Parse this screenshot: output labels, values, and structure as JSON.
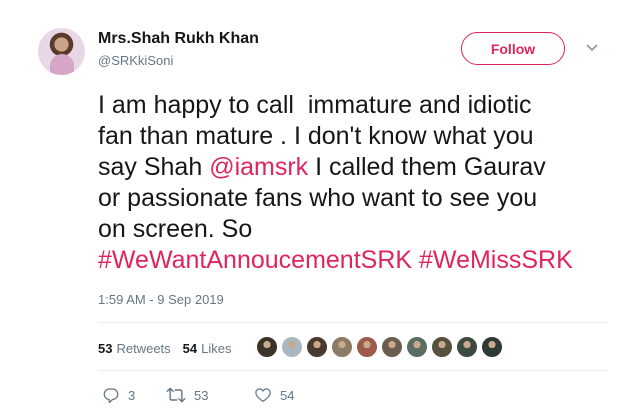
{
  "author": {
    "display_name": "Mrs.Shah Rukh Khan",
    "handle": "@SRKkiSoni"
  },
  "follow_button": {
    "label": "Follow"
  },
  "tweet": {
    "lines": [
      [
        {
          "text": "I am happy to call  immature and idiotic",
          "link": false
        }
      ],
      [
        {
          "text": "fan than mature . I don't know what you",
          "link": false
        }
      ],
      [
        {
          "text": "say Shah ",
          "link": false
        },
        {
          "text": "@iamsrk",
          "link": true
        },
        {
          "text": " I called them Gaurav",
          "link": false
        }
      ],
      [
        {
          "text": "or passionate fans who want to see you",
          "link": false
        }
      ],
      [
        {
          "text": "on screen. So",
          "link": false
        }
      ],
      [
        {
          "text": "#WeWantAnnoucementSRK",
          "link": true
        },
        {
          "text": " ",
          "link": false
        },
        {
          "text": "#WeMissSRK",
          "link": true
        }
      ]
    ]
  },
  "timestamp": "1:59 AM - 9 Sep 2019",
  "stats": {
    "retweets_count": "53",
    "retweets_label": "Retweets",
    "likes_count": "54",
    "likes_label": "Likes"
  },
  "likers": [
    {
      "color": "#3b3428"
    },
    {
      "color": "#aab8c2"
    },
    {
      "color": "#4a3a2e"
    },
    {
      "color": "#8c7b66"
    },
    {
      "color": "#9e5a4a"
    },
    {
      "color": "#6b5d4f"
    },
    {
      "color": "#5b6e63"
    },
    {
      "color": "#56503f"
    },
    {
      "color": "#3d4a3f"
    },
    {
      "color": "#2f3a33"
    }
  ],
  "actions": {
    "reply_count": "3",
    "retweet_count": "53",
    "like_count": "54"
  },
  "colors": {
    "accent": "#e0245e",
    "secondary_text": "#657786",
    "primary_text": "#14171a",
    "divider": "#e6ecf0"
  },
  "icons": {
    "caret": "chevron-down-icon",
    "reply": "reply-icon",
    "retweet": "retweet-icon",
    "like": "heart-icon"
  }
}
